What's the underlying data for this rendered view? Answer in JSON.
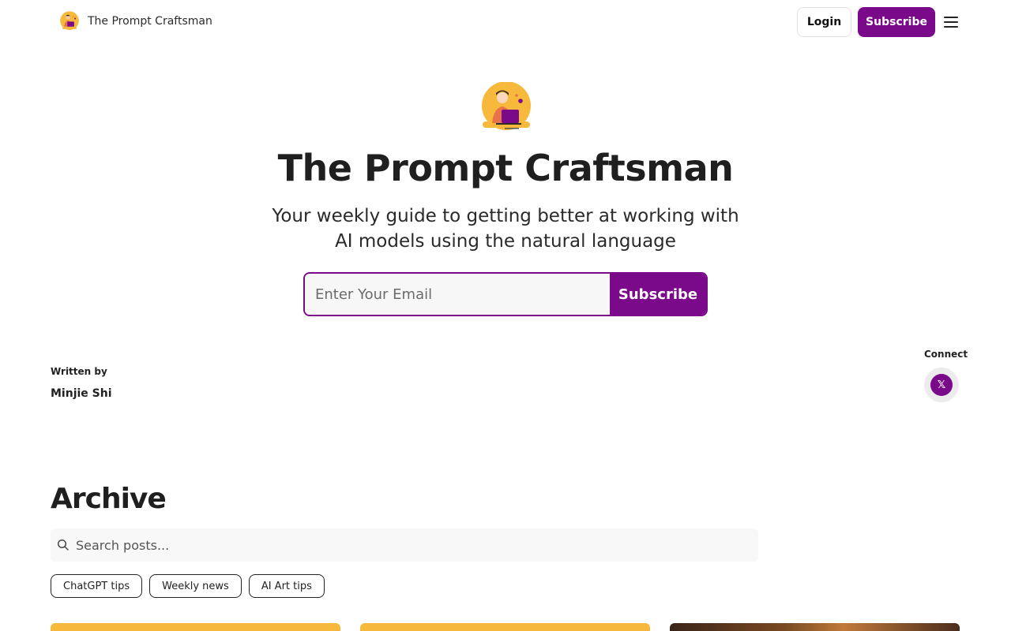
{
  "nav": {
    "brand_name": "The Prompt Craftsman",
    "login_label": "Login",
    "subscribe_label": "Subscribe",
    "menu_icon": "hamburger-menu-icon"
  },
  "hero": {
    "title": "The Prompt Craftsman",
    "subtitle": "Your weekly guide to getting better at working with AI models using the natural language",
    "email_placeholder": "Enter Your Email",
    "subscribe_label": "Subscribe"
  },
  "author": {
    "written_by_label": "Written by",
    "name": "Minjie Shi"
  },
  "connect": {
    "label": "Connect",
    "x_glyph": "𝕏"
  },
  "archive": {
    "title": "Archive",
    "search_placeholder": "Search posts...",
    "tags": [
      "ChatGPT tips",
      "Weekly news",
      "AI Art tips"
    ]
  },
  "colors": {
    "accent": "#7b0a8a",
    "logo_yellow": "#f6b93b"
  }
}
